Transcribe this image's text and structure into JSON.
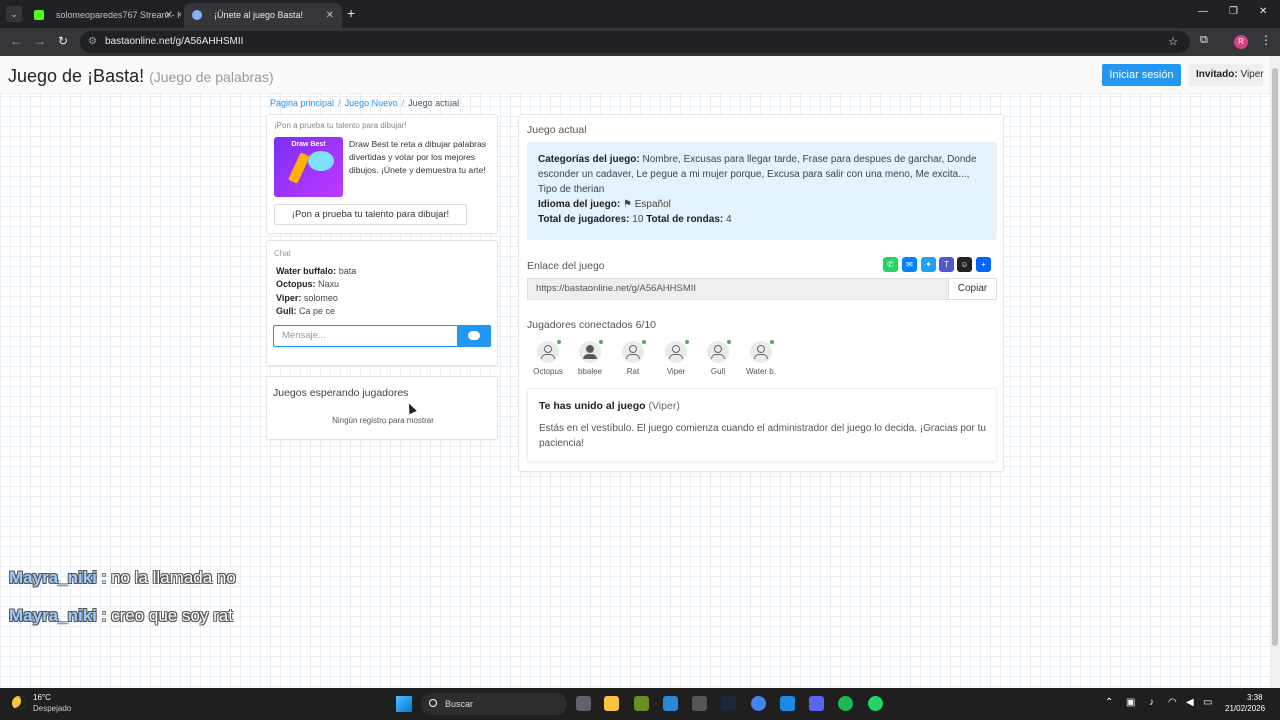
{
  "browser": {
    "tabs": [
      {
        "title": "solomeoparedes767 Stream - K"
      },
      {
        "title": "¡Únete al juego Basta!"
      }
    ],
    "url": "bastaonline.net/g/A56AHHSMII"
  },
  "header": {
    "title": "Juego de ¡Basta!",
    "subtitle": "(Juego de palabras)",
    "login_label": "Iniciar sesión",
    "guest_label": "Invitado:",
    "guest_name": "Viper"
  },
  "breadcrumb": {
    "home": "Página principal",
    "new_game": "Juego Nuevo",
    "current": "Juego actual"
  },
  "ad": {
    "heading": "¡Pon a prueba tu talento para dibujar!",
    "image_title": "Draw Best",
    "text": "Draw Best te reta a dibujar palabras divertidas y votar por los mejores dibujos. ¡Únete y demuestra tu arte!",
    "button_label": "¡Pon a prueba tu talento para dibujar!"
  },
  "chat": {
    "heading": "Chat",
    "messages": [
      {
        "user": "Water buffalo:",
        "text": "bata"
      },
      {
        "user": "Octopus:",
        "text": "Naxu"
      },
      {
        "user": "Viper:",
        "text": "solomeo"
      },
      {
        "user": "Gull:",
        "text": "Ca pe ce"
      }
    ],
    "placeholder": "Mensaje..."
  },
  "waiting": {
    "heading": "Juegos esperando jugadores",
    "empty": "Ningún registro para mostrar"
  },
  "game": {
    "heading": "Juego actual",
    "categories_label": "Categorías del juego:",
    "categories": "Nombre, Excusas para llegar tarde, Frase para despues de garchar, Donde esconder un cadaver, Le pegue a mi mujer porque, Excusa para salir con una meno, Me excita..., Tipo de therian",
    "language_label": "Idioma del juego:",
    "language": "Español",
    "players_total_label": "Total de jugadores:",
    "players_total": "10",
    "rounds_label": "Total de rondas:",
    "rounds": "4",
    "link_heading": "Enlace del juego",
    "link": "https://bastaonline.net/g/A56AHHSMII",
    "copy_label": "Copiar",
    "connected_heading": "Jugadores conectados 6/10",
    "players": [
      "Octopus",
      "bbalee",
      "Rat",
      "Viper",
      "Gull",
      "Water b."
    ],
    "joined_title": "Te has unido al juego",
    "joined_user": "(Viper)",
    "joined_text": "Estás en el vestíbulo. El juego comienza cuando el administrador del juego lo decida. ¡Gracias por tu paciencia!"
  },
  "stream_overlay": [
    {
      "user": "Mayra_niki",
      "text": ": no la llamada no"
    },
    {
      "user": "Mayra_niki",
      "text": ": creo que soy rat"
    }
  ],
  "taskbar": {
    "temperature": "16°C",
    "weather": "Despejado",
    "search_label": "Buscar",
    "time": "3:38",
    "date": "21/02/2026"
  },
  "colors": {
    "accent": "#2196f3",
    "info_bg": "#e3f2fd",
    "online_dot": "#4caf50"
  }
}
